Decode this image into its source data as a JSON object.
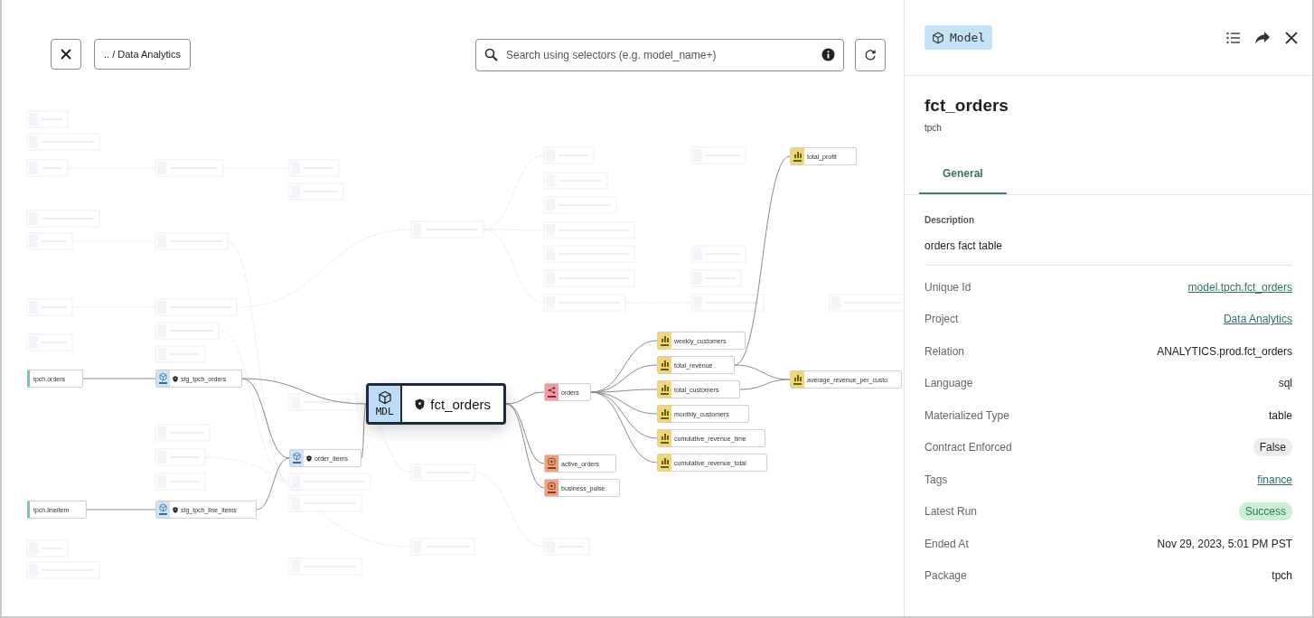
{
  "toolbar": {
    "breadcrumb": ".. / Data Analytics",
    "search": {
      "placeholder": "Search using selectors (e.g. model_name+)"
    }
  },
  "graph": {
    "nodes": [
      {
        "label": "tpch.orders",
        "kind": "source",
        "focused": false
      },
      {
        "label": "stg_tpch_orders",
        "kind": "model",
        "focused": false
      },
      {
        "label": "tpch.lineitem",
        "kind": "source",
        "focused": false
      },
      {
        "label": "stg_tpch_line_items",
        "kind": "model",
        "focused": false
      },
      {
        "label": "order_items",
        "kind": "model",
        "focused": false
      },
      {
        "label": "fct_orders",
        "kind": "model",
        "focused": true,
        "badge": "MDL"
      },
      {
        "label": "orders",
        "kind": "semantic_model",
        "focused": false
      },
      {
        "label": "active_orders",
        "kind": "exposure",
        "focused": false
      },
      {
        "label": "business_pulse",
        "kind": "exposure",
        "focused": false
      },
      {
        "label": "weekly_customers",
        "kind": "metric",
        "focused": false
      },
      {
        "label": "total_revenue",
        "kind": "metric",
        "focused": false
      },
      {
        "label": "total_customers",
        "kind": "metric",
        "focused": false
      },
      {
        "label": "monthly_customers",
        "kind": "metric",
        "focused": false
      },
      {
        "label": "cumulative_revenue_time",
        "kind": "metric",
        "focused": false
      },
      {
        "label": "cumulative_revenue_total",
        "kind": "metric",
        "focused": false
      },
      {
        "label": "total_profit",
        "kind": "metric",
        "focused": false
      },
      {
        "label": "average_revenue_per_custo",
        "kind": "metric",
        "focused": false
      }
    ]
  },
  "panel": {
    "type_badge": "Model",
    "title": "fct_orders",
    "subtitle": "tpch",
    "tabs": [
      {
        "label": "General",
        "selected": true
      }
    ],
    "description_label": "Description",
    "description": "orders fact table",
    "fields": [
      {
        "label": "Unique Id",
        "value": "model.tpch.fct_orders",
        "kind": "link"
      },
      {
        "label": "Project",
        "value": "Data Analytics",
        "kind": "link"
      },
      {
        "label": "Relation",
        "value": "ANALYTICS.prod.fct_orders",
        "kind": "text"
      },
      {
        "label": "Language",
        "value": "sql",
        "kind": "text"
      },
      {
        "label": "Materialized Type",
        "value": "table",
        "kind": "text"
      },
      {
        "label": "Contract Enforced",
        "value": "False",
        "kind": "neutral_pill"
      },
      {
        "label": "Tags",
        "value": "finance",
        "kind": "link"
      },
      {
        "label": "Latest Run",
        "value": "Success",
        "kind": "success_pill"
      },
      {
        "label": "Ended At",
        "value": "Nov 29, 2023, 5:01 PM PST",
        "kind": "text"
      },
      {
        "label": "Package",
        "value": "tpch",
        "kind": "text"
      }
    ]
  }
}
